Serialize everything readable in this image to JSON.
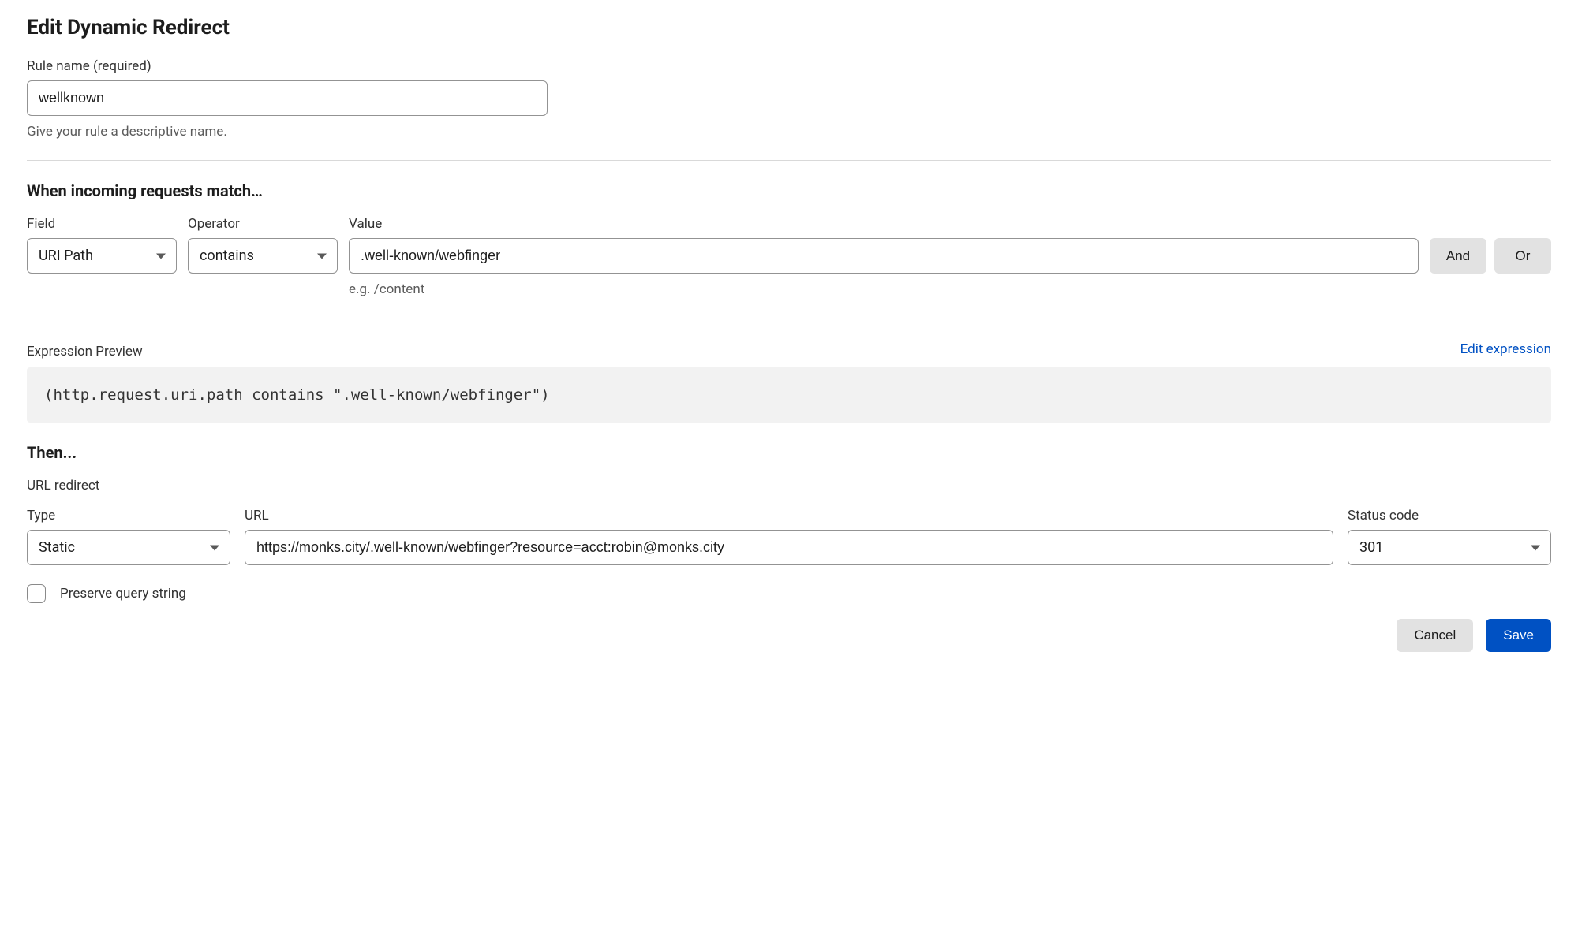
{
  "title": "Edit Dynamic Redirect",
  "ruleName": {
    "label": "Rule name (required)",
    "value": "wellknown",
    "helper": "Give your rule a descriptive name."
  },
  "conditions": {
    "heading": "When incoming requests match…",
    "fieldLabel": "Field",
    "operatorLabel": "Operator",
    "valueLabel": "Value",
    "fieldValue": "URI Path",
    "operatorValue": "contains",
    "value": ".well-known/webfinger",
    "valueHint": "e.g. /content",
    "andLabel": "And",
    "orLabel": "Or"
  },
  "preview": {
    "label": "Expression Preview",
    "editLink": "Edit expression",
    "text": "(http.request.uri.path contains \".well-known/webfinger\")"
  },
  "then": {
    "heading": "Then...",
    "subheader": "URL redirect",
    "typeLabel": "Type",
    "typeValue": "Static",
    "urlLabel": "URL",
    "urlValue": "https://monks.city/.well-known/webfinger?resource=acct:robin@monks.city",
    "statusLabel": "Status code",
    "statusValue": "301",
    "preserveLabel": "Preserve query string"
  },
  "footer": {
    "cancel": "Cancel",
    "save": "Save"
  }
}
